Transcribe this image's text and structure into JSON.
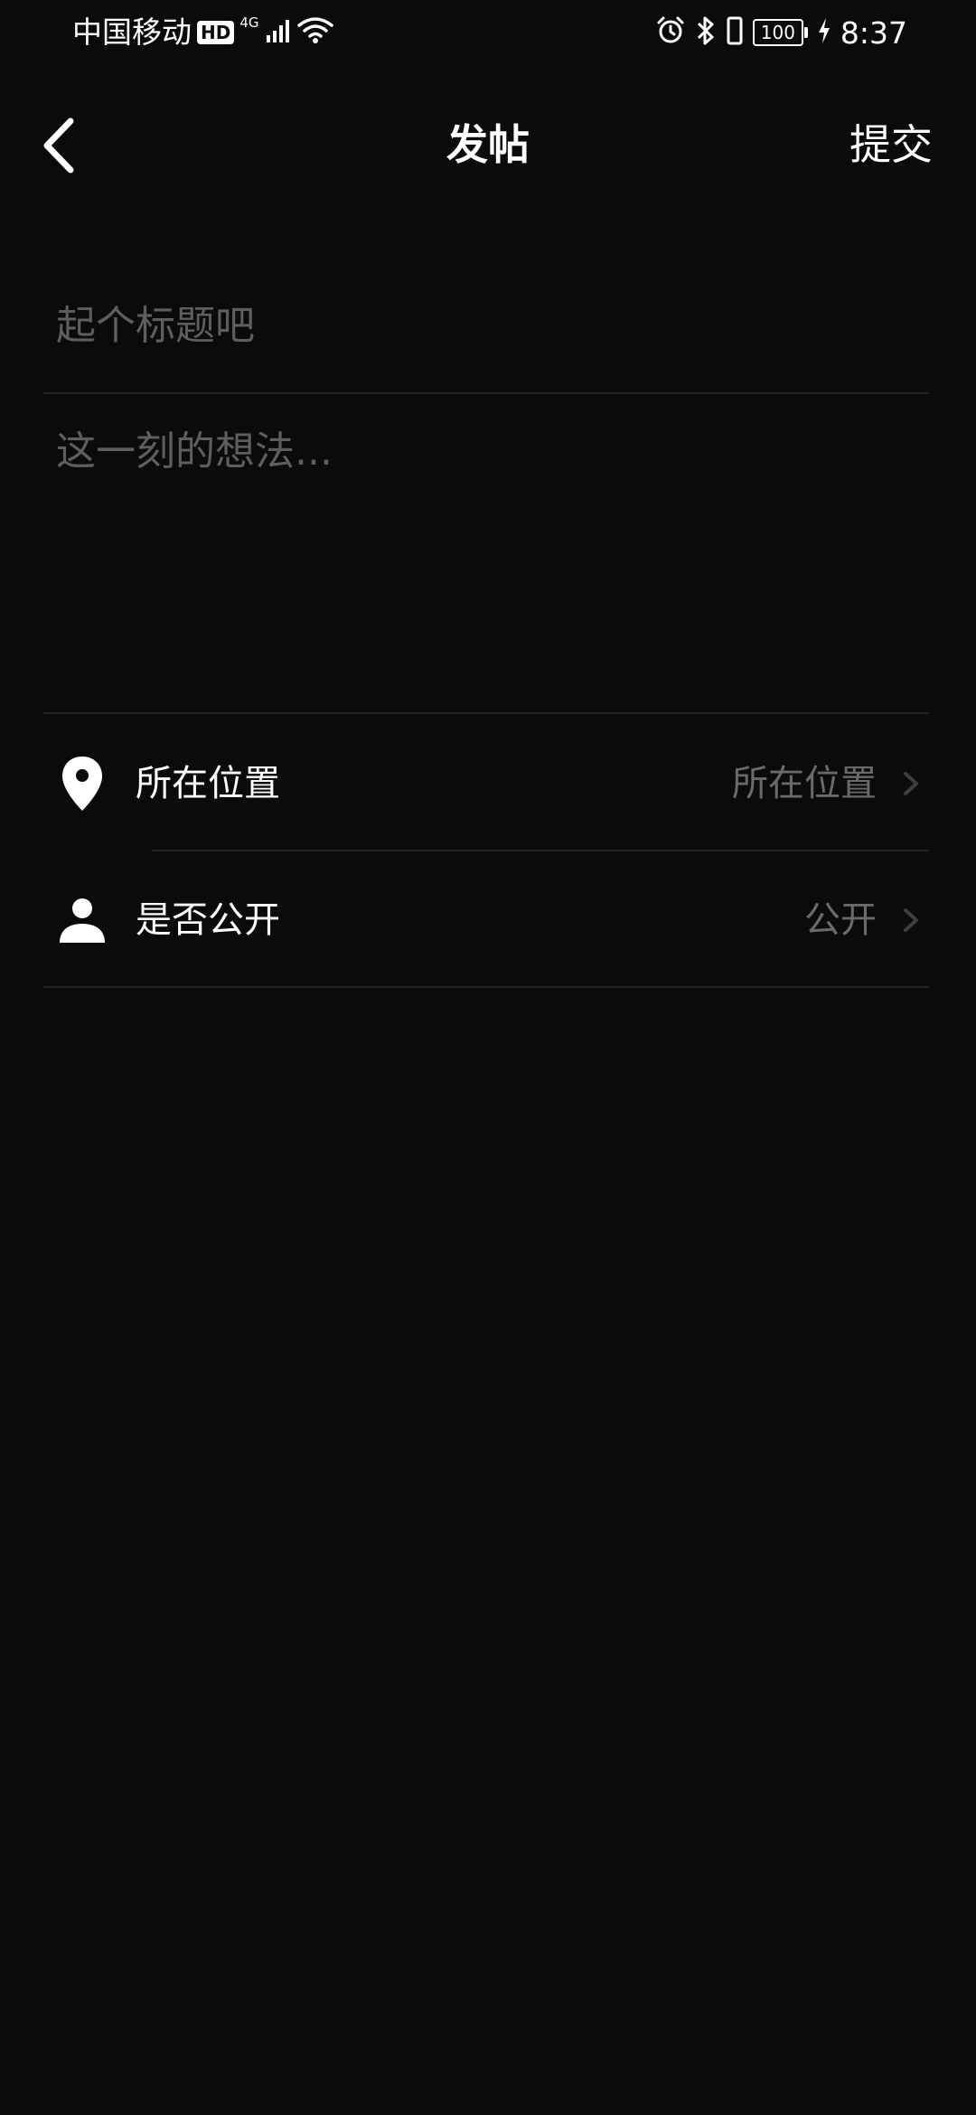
{
  "status_bar": {
    "carrier": "中国移动",
    "hd": "HD",
    "network": "4G",
    "battery": "100",
    "time": "8:37",
    "icons": [
      "signal-icon",
      "wifi-icon",
      "alarm-icon",
      "bluetooth-icon",
      "vibrate-icon",
      "charging-icon"
    ]
  },
  "header": {
    "title": "发帖",
    "submit_label": "提交",
    "back_icon": "chevron-left-icon"
  },
  "form": {
    "title_placeholder": "起个标题吧",
    "content_placeholder": "这一刻的想法..."
  },
  "options": [
    {
      "label": "所在位置",
      "value": "所在位置",
      "icon": "location-pin-icon"
    },
    {
      "label": "是否公开",
      "value": "公开",
      "icon": "person-icon"
    }
  ],
  "colors": {
    "background": "#0b0b0c",
    "text": "#ffffff",
    "placeholder": "#5e5e60",
    "divider": "#222224",
    "secondary_text": "#6a6a6c"
  }
}
